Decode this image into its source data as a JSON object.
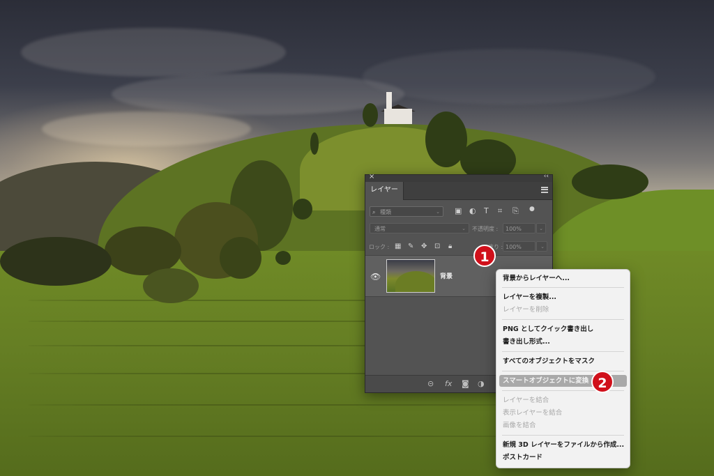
{
  "panel": {
    "close_glyph": "×",
    "collapse_glyph": "‹‹",
    "tab_label": "レイヤー",
    "filter_placeholder": "種類",
    "blend_mode": "通常",
    "opacity_label": "不透明度 :",
    "opacity_value": "100%",
    "lock_label": "ロック :",
    "fill_label": "塗り :",
    "fill_value": "100%",
    "layers": [
      {
        "name": "背景",
        "visible": true
      }
    ]
  },
  "context_menu": {
    "items": [
      {
        "label": "背景からレイヤーへ...",
        "enabled": true
      },
      {
        "label": "レイヤーを複製...",
        "enabled": true
      },
      {
        "label": "レイヤーを削除",
        "enabled": false
      },
      {
        "label": "PNG としてクイック書き出し",
        "enabled": true
      },
      {
        "label": "書き出し形式...",
        "enabled": true
      },
      {
        "label": "すべてのオブジェクトをマスク",
        "enabled": true
      },
      {
        "label": "スマートオブジェクトに変換",
        "enabled": true,
        "highlighted": true
      },
      {
        "label": "レイヤーを結合",
        "enabled": false
      },
      {
        "label": "表示レイヤーを結合",
        "enabled": false
      },
      {
        "label": "画像を結合",
        "enabled": false
      },
      {
        "label": "新規 3D レイヤーをファイルから作成...",
        "enabled": true
      },
      {
        "label": "ポストカード",
        "enabled": true
      }
    ]
  },
  "badges": {
    "step1": "1",
    "step2": "2"
  },
  "colors": {
    "badge": "#d0101b",
    "panel_bg": "#535353",
    "menu_bg": "#f2f2f2",
    "menu_highlight": "#a9a9a9"
  }
}
